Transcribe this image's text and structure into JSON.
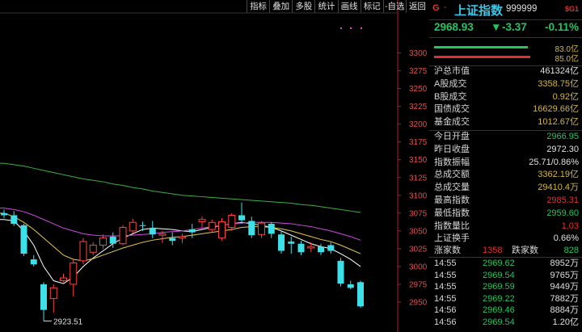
{
  "toolbar": [
    "指标",
    "叠加",
    "多股",
    "统计",
    "画线",
    "标记",
    "-自选",
    "返回"
  ],
  "axis": {
    "ticks": [
      3300,
      3275,
      3250,
      3225,
      3200,
      3175,
      3150,
      3125,
      3100,
      3075,
      3050,
      3025,
      3000,
      2975,
      2950
    ],
    "ymin": 2925,
    "ymax": 3312
  },
  "chart_data": {
    "type": "candlestick",
    "low_annotation": "2923.51",
    "candles": [
      {
        "o": 3075,
        "h": 3080,
        "l": 3068,
        "c": 3072
      },
      {
        "o": 3072,
        "h": 3078,
        "l": 3057,
        "c": 3060
      },
      {
        "o": 3058,
        "h": 3060,
        "l": 3015,
        "c": 3018
      },
      {
        "o": 3010,
        "h": 3016,
        "l": 3000,
        "c": 3003
      },
      {
        "o": 2975,
        "h": 2978,
        "l": 2923.51,
        "c": 2939
      },
      {
        "o": 2955,
        "h": 2975,
        "l": 2935,
        "c": 2970
      },
      {
        "o": 2980,
        "h": 2990,
        "l": 2978,
        "c": 2984
      },
      {
        "o": 2975,
        "h": 3010,
        "l": 2958,
        "c": 3005
      },
      {
        "o": 3008,
        "h": 3040,
        "l": 3003,
        "c": 3035
      },
      {
        "o": 3020,
        "h": 3034,
        "l": 3016,
        "c": 3030
      },
      {
        "o": 3030,
        "h": 3045,
        "l": 3025,
        "c": 3040
      },
      {
        "o": 3042,
        "h": 3048,
        "l": 3026,
        "c": 3032
      },
      {
        "o": 3032,
        "h": 3058,
        "l": 3030,
        "c": 3055
      },
      {
        "o": 3050,
        "h": 3067,
        "l": 3047,
        "c": 3062
      },
      {
        "o": 3058,
        "h": 3063,
        "l": 3050,
        "c": 3057
      },
      {
        "o": 3054,
        "h": 3064,
        "l": 3040,
        "c": 3045
      },
      {
        "o": 3044,
        "h": 3050,
        "l": 3033,
        "c": 3046
      },
      {
        "o": 3040,
        "h": 3048,
        "l": 3030,
        "c": 3036
      },
      {
        "o": 3040,
        "h": 3046,
        "l": 3033,
        "c": 3042
      },
      {
        "o": 3052,
        "h": 3060,
        "l": 3040,
        "c": 3048
      },
      {
        "o": 3063,
        "h": 3070,
        "l": 3055,
        "c": 3066
      },
      {
        "o": 3052,
        "h": 3066,
        "l": 3048,
        "c": 3062
      },
      {
        "o": 3040,
        "h": 3068,
        "l": 3036,
        "c": 3063
      },
      {
        "o": 3055,
        "h": 3075,
        "l": 3050,
        "c": 3072
      },
      {
        "o": 3072,
        "h": 3090,
        "l": 3060,
        "c": 3065
      },
      {
        "o": 3064,
        "h": 3070,
        "l": 3040,
        "c": 3044
      },
      {
        "o": 3045,
        "h": 3064,
        "l": 3040,
        "c": 3061
      },
      {
        "o": 3060,
        "h": 3062,
        "l": 3040,
        "c": 3046
      },
      {
        "o": 3045,
        "h": 3050,
        "l": 3018,
        "c": 3022
      },
      {
        "o": 3035,
        "h": 3042,
        "l": 3018,
        "c": 3032
      },
      {
        "o": 3032,
        "h": 3036,
        "l": 3016,
        "c": 3020
      },
      {
        "o": 3026,
        "h": 3034,
        "l": 3020,
        "c": 3028
      },
      {
        "o": 3028,
        "h": 3032,
        "l": 3016,
        "c": 3020
      },
      {
        "o": 3030,
        "h": 3034,
        "l": 3018,
        "c": 3022
      },
      {
        "o": 3008,
        "h": 3012,
        "l": 2972,
        "c": 2976
      },
      {
        "o": 2975,
        "h": 2980,
        "l": 2968,
        "c": 2970
      },
      {
        "o": 2978,
        "h": 2980,
        "l": 2942,
        "c": 2944
      }
    ],
    "ma": [
      {
        "color": "#ffffff",
        "values": [
          3066,
          3064,
          3050,
          3030,
          3000,
          2980,
          2976,
          2985,
          3000,
          3012,
          3022,
          3032,
          3040,
          3046,
          3052,
          3054,
          3053,
          3052,
          3050,
          3049,
          3052,
          3055,
          3058,
          3060,
          3062,
          3060,
          3058,
          3055,
          3050,
          3044,
          3038,
          3032,
          3028,
          3025,
          3018,
          3010,
          3000
        ]
      },
      {
        "color": "#e8c84a",
        "values": [
          3075,
          3070,
          3062,
          3052,
          3040,
          3028,
          3016,
          3010,
          3008,
          3011,
          3016,
          3021,
          3026,
          3030,
          3034,
          3037,
          3039,
          3041,
          3042,
          3044,
          3046,
          3048,
          3050,
          3052,
          3055,
          3056,
          3056,
          3055,
          3053,
          3050,
          3046,
          3042,
          3038,
          3035,
          3030,
          3024,
          3018
        ]
      },
      {
        "color": "#d048e0",
        "values": [
          3082,
          3080,
          3077,
          3072,
          3066,
          3060,
          3054,
          3050,
          3046,
          3044,
          3043,
          3043,
          3043,
          3044,
          3045,
          3046,
          3048,
          3049,
          3050,
          3052,
          3054,
          3056,
          3058,
          3060,
          3061,
          3062,
          3062,
          3062,
          3061,
          3060,
          3058,
          3056,
          3053,
          3050,
          3046,
          3042,
          3037
        ]
      },
      {
        "color": "#3cb043",
        "values": [
          3145,
          3143,
          3141,
          3138,
          3135,
          3132,
          3129,
          3126,
          3123,
          3121,
          3119,
          3116,
          3114,
          3111,
          3109,
          3106,
          3104,
          3102,
          3100,
          3099,
          3098,
          3097,
          3096,
          3095,
          3094,
          3093,
          3092,
          3091,
          3090,
          3089,
          3087,
          3086,
          3084,
          3082,
          3080,
          3078,
          3076
        ]
      }
    ]
  },
  "header": {
    "prefix": "G",
    "dash": "-",
    "name": "上证指数",
    "code": "999999",
    "tag": "$G1"
  },
  "price": {
    "last": "2968.93",
    "arrow": "▼",
    "change": "-3.37",
    "pct": "-0.11%"
  },
  "bars": {
    "green_val": "83.0亿",
    "red_val": "85.0亿",
    "green_frac": 0.83,
    "red_frac": 0.85
  },
  "stats1": [
    {
      "label": "沪总市值",
      "value": "461324亿",
      "color": "#e0e0e0"
    },
    {
      "label": "A股成交",
      "value": "3358.75亿",
      "color": "#d4b840"
    },
    {
      "label": "B股成交",
      "value": "0.92亿",
      "color": "#d4b840"
    },
    {
      "label": "国债成交",
      "value": "16629.66亿",
      "color": "#d4b840"
    },
    {
      "label": "基金成交",
      "value": "1012.67亿",
      "color": "#d4b840"
    }
  ],
  "stats2": [
    {
      "label": "今日开盘",
      "value": "2966.95",
      "color": "#22c55e"
    },
    {
      "label": "昨日收盘",
      "value": "2972.30",
      "color": "#e0e0e0"
    },
    {
      "label": "指数振幅",
      "value": "25.71/0.86%",
      "color": "#e0e0e0"
    },
    {
      "label": "总成交额",
      "value": "3362.19亿",
      "color": "#d4b840"
    },
    {
      "label": "总成交量",
      "value": "29410.4万",
      "color": "#d4b840"
    },
    {
      "label": "最高指数",
      "value": "2985.31",
      "color": "#e03030"
    },
    {
      "label": "最低指数",
      "value": "2959.60",
      "color": "#22c55e"
    },
    {
      "label": "指数量比",
      "value": "1.03",
      "color": "#e03030"
    },
    {
      "label": "上证换手",
      "value": "0.66%",
      "color": "#e0e0e0"
    }
  ],
  "updown": {
    "up_label": "涨家数",
    "up": "1358",
    "down_label": "跌家数",
    "down": "828"
  },
  "ticks": [
    {
      "time": "14:55",
      "price": "2969.62",
      "vol": "8952万"
    },
    {
      "time": "14:55",
      "price": "2969.54",
      "vol": "9765万"
    },
    {
      "time": "14:55",
      "price": "2969.59",
      "vol": "9449万"
    },
    {
      "time": "14:55",
      "price": "2969.22",
      "vol": "7882万"
    },
    {
      "time": "14:56",
      "price": "2969.46",
      "vol": "8884万"
    },
    {
      "time": "14:56",
      "price": "2969.54",
      "vol": "1.20亿"
    }
  ]
}
